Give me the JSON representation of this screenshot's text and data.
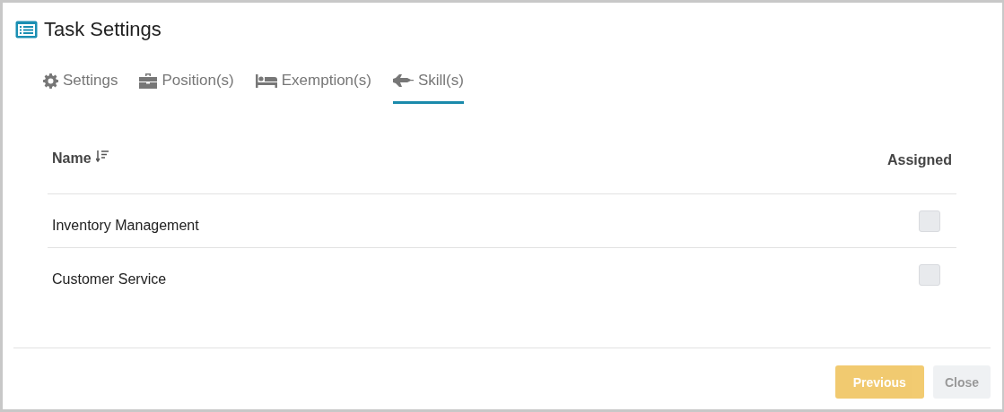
{
  "window": {
    "title": "Task Settings"
  },
  "tabs": [
    {
      "label": "Settings",
      "kind": "gear",
      "selected": false
    },
    {
      "label": "Position(s)",
      "kind": "briefcase",
      "selected": false
    },
    {
      "label": "Exemption(s)",
      "kind": "bed",
      "selected": false
    },
    {
      "label": "Skill(s)",
      "kind": "jet",
      "selected": true
    }
  ],
  "table": {
    "columns": [
      {
        "label": "Name",
        "sorted": true
      },
      {
        "label": "Assigned",
        "sorted": false
      }
    ],
    "rows": [
      {
        "name": "Inventory Management",
        "assigned": false
      },
      {
        "name": "Customer Service",
        "assigned": false
      }
    ]
  },
  "buttons": [
    {
      "label": "Previous",
      "kind": "primary",
      "disabled": true
    },
    {
      "label": "Close",
      "kind": "secondary",
      "disabled": true
    }
  ]
}
